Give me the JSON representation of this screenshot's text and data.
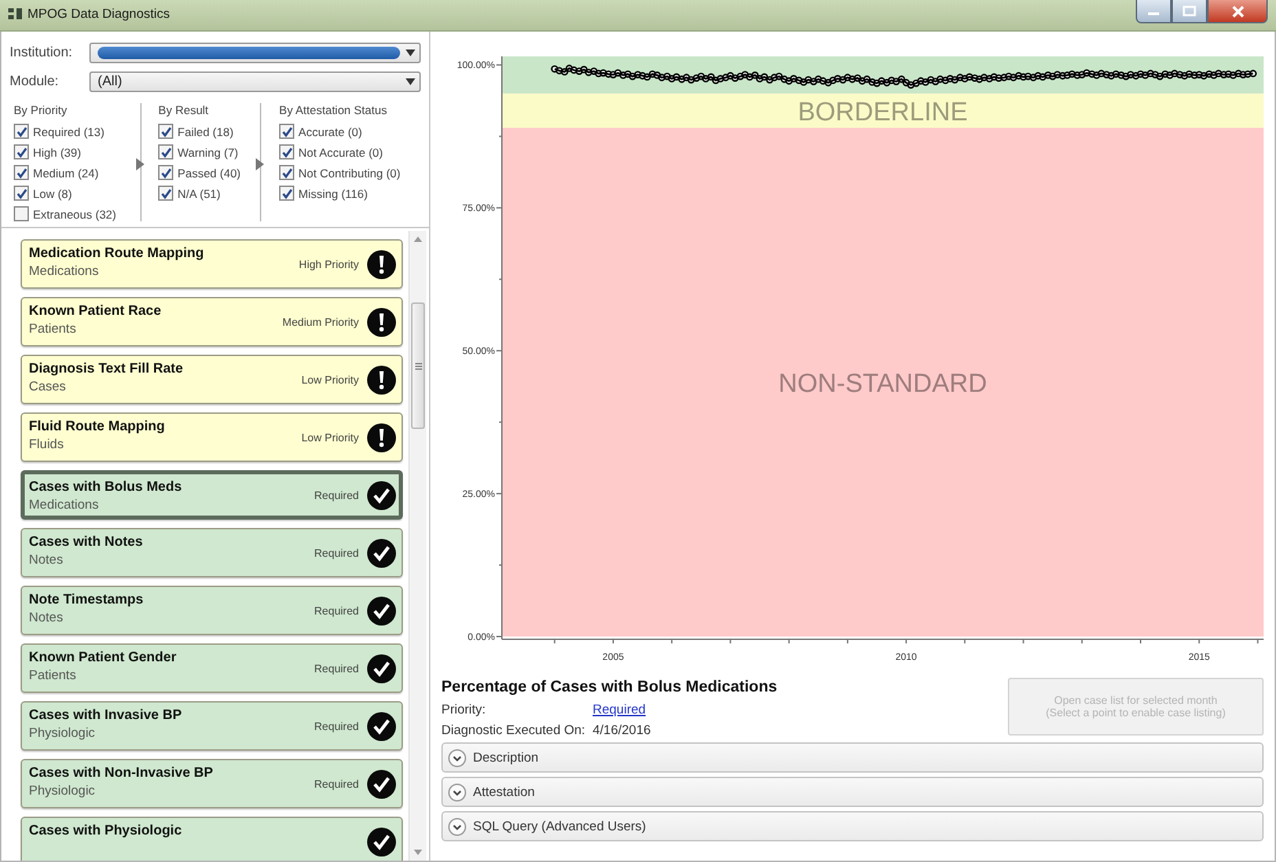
{
  "window": {
    "title": "MPOG Data Diagnostics"
  },
  "filters": {
    "institution": {
      "label": "Institution:"
    },
    "module": {
      "label": "Module:",
      "value": "(All)"
    },
    "groups": [
      {
        "title": "By Priority",
        "options": [
          {
            "label": "Required (13)",
            "checked": true
          },
          {
            "label": "High (39)",
            "checked": true
          },
          {
            "label": "Medium (24)",
            "checked": true
          },
          {
            "label": "Low (8)",
            "checked": true
          },
          {
            "label": "Extraneous (32)",
            "checked": false
          }
        ]
      },
      {
        "title": "By Result",
        "options": [
          {
            "label": "Failed (18)",
            "checked": true
          },
          {
            "label": "Warning (7)",
            "checked": true
          },
          {
            "label": "Passed (40)",
            "checked": true
          },
          {
            "label": "N/A (51)",
            "checked": true
          }
        ]
      },
      {
        "title": "By Attestation Status",
        "options": [
          {
            "label": "Accurate (0)",
            "checked": true
          },
          {
            "label": "Not Accurate (0)",
            "checked": true
          },
          {
            "label": "Not Contributing (0)",
            "checked": true
          },
          {
            "label": "Missing (116)",
            "checked": true
          }
        ]
      }
    ]
  },
  "diagnostics": [
    {
      "title": "Medication Route Mapping",
      "category": "Medications",
      "priority": "High Priority",
      "kind": "warning",
      "selected": false
    },
    {
      "title": "Known Patient Race",
      "category": "Patients",
      "priority": "Medium Priority",
      "kind": "warning",
      "selected": false
    },
    {
      "title": "Diagnosis Text Fill Rate",
      "category": "Cases",
      "priority": "Low Priority",
      "kind": "warning",
      "selected": false
    },
    {
      "title": "Fluid Route Mapping",
      "category": "Fluids",
      "priority": "Low Priority",
      "kind": "warning",
      "selected": false
    },
    {
      "title": "Cases with Bolus Meds",
      "category": "Medications",
      "priority": "Required",
      "kind": "passed",
      "selected": true
    },
    {
      "title": "Cases with Notes",
      "category": "Notes",
      "priority": "Required",
      "kind": "passed",
      "selected": false
    },
    {
      "title": "Note Timestamps",
      "category": "Notes",
      "priority": "Required",
      "kind": "passed",
      "selected": false
    },
    {
      "title": "Known Patient Gender",
      "category": "Patients",
      "priority": "Required",
      "kind": "passed",
      "selected": false
    },
    {
      "title": "Cases with Invasive BP",
      "category": "Physiologic",
      "priority": "Required",
      "kind": "passed",
      "selected": false
    },
    {
      "title": "Cases with Non-Invasive BP",
      "category": "Physiologic",
      "priority": "Required",
      "kind": "passed",
      "selected": false
    },
    {
      "title": "Cases with Physiologic",
      "kind": "passed",
      "selected": false
    }
  ],
  "chart": {
    "chart_data": {
      "type": "line",
      "xlim": [
        2003.1,
        2016.1
      ],
      "ylim": [
        0,
        101.5
      ],
      "xticks": [
        2005,
        2010,
        2015
      ],
      "yticks": [
        {
          "value": 0,
          "label": "0.00%"
        },
        {
          "value": 25,
          "label": "25.00%"
        },
        {
          "value": 50,
          "label": "50.00%"
        },
        {
          "value": 75,
          "label": "75.00%"
        },
        {
          "value": 100,
          "label": "100.00%"
        }
      ],
      "bands": [
        {
          "axis": "y",
          "from": 95,
          "to": 101.5,
          "color": "#c9e6c9"
        },
        {
          "axis": "y",
          "from": 89,
          "to": 95,
          "color": "#fbfbc8",
          "label": "BORDERLINE"
        },
        {
          "axis": "y",
          "from": 0,
          "to": 89,
          "color": "#ffcaca",
          "label": "NON-STANDARD"
        }
      ],
      "x": [
        2004,
        2004.08,
        2004.17,
        2004.25,
        2004.33,
        2004.42,
        2004.5,
        2004.58,
        2004.67,
        2004.75,
        2004.83,
        2004.92,
        2005,
        2005.08,
        2005.17,
        2005.25,
        2005.33,
        2005.42,
        2005.5,
        2005.58,
        2005.67,
        2005.75,
        2005.83,
        2005.92,
        2006,
        2006.08,
        2006.17,
        2006.25,
        2006.33,
        2006.42,
        2006.5,
        2006.58,
        2006.67,
        2006.75,
        2006.83,
        2006.92,
        2007,
        2007.08,
        2007.17,
        2007.25,
        2007.33,
        2007.42,
        2007.5,
        2007.58,
        2007.67,
        2007.75,
        2007.83,
        2007.92,
        2008,
        2008.08,
        2008.17,
        2008.25,
        2008.33,
        2008.42,
        2008.5,
        2008.58,
        2008.67,
        2008.75,
        2008.83,
        2008.92,
        2009,
        2009.08,
        2009.17,
        2009.25,
        2009.33,
        2009.42,
        2009.5,
        2009.58,
        2009.67,
        2009.75,
        2009.83,
        2009.92,
        2010,
        2010.08,
        2010.17,
        2010.25,
        2010.33,
        2010.42,
        2010.5,
        2010.58,
        2010.67,
        2010.75,
        2010.83,
        2010.92,
        2011,
        2011.08,
        2011.17,
        2011.25,
        2011.33,
        2011.42,
        2011.5,
        2011.58,
        2011.67,
        2011.75,
        2011.83,
        2011.92,
        2012,
        2012.08,
        2012.17,
        2012.25,
        2012.33,
        2012.42,
        2012.5,
        2012.58,
        2012.67,
        2012.75,
        2012.83,
        2012.92,
        2013,
        2013.08,
        2013.17,
        2013.25,
        2013.33,
        2013.42,
        2013.5,
        2013.58,
        2013.67,
        2013.75,
        2013.83,
        2013.92,
        2014,
        2014.08,
        2014.17,
        2014.25,
        2014.33,
        2014.42,
        2014.5,
        2014.58,
        2014.67,
        2014.75,
        2014.83,
        2014.92,
        2015,
        2015.08,
        2015.17,
        2015.25,
        2015.33,
        2015.42,
        2015.5,
        2015.58,
        2015.67,
        2015.75,
        2015.83,
        2015.92
      ],
      "series": [
        {
          "color": "#000000",
          "marker": "circle",
          "values": [
            99.3,
            99.0,
            98.8,
            99.4,
            99.1,
            98.9,
            99.2,
            98.7,
            98.9,
            98.5,
            98.6,
            98.4,
            98.3,
            98.6,
            98.2,
            98.4,
            98.0,
            98.3,
            98.1,
            97.9,
            98.4,
            98.2,
            97.8,
            98.0,
            97.6,
            97.9,
            97.5,
            97.8,
            97.4,
            97.7,
            98.0,
            97.6,
            97.9,
            97.3,
            97.6,
            97.8,
            98.1,
            97.7,
            98.0,
            98.3,
            97.9,
            98.2,
            97.6,
            97.9,
            97.4,
            97.8,
            98.0,
            97.5,
            97.2,
            97.6,
            97.3,
            97.0,
            97.4,
            97.1,
            97.5,
            97.2,
            96.9,
            97.3,
            97.6,
            97.4,
            97.8,
            97.5,
            97.7,
            97.2,
            97.5,
            97.0,
            96.8,
            97.2,
            96.9,
            97.3,
            97.1,
            97.5,
            96.9,
            96.5,
            96.8,
            97.2,
            97.0,
            97.4,
            97.1,
            97.5,
            97.3,
            97.6,
            97.4,
            97.8,
            97.6,
            97.9,
            97.7,
            97.5,
            97.8,
            97.6,
            97.9,
            97.7,
            97.8,
            98.0,
            97.8,
            98.1,
            97.9,
            98.0,
            97.8,
            98.1,
            97.9,
            98.2,
            98.0,
            98.3,
            98.1,
            98.2,
            98.4,
            98.2,
            98.3,
            98.6,
            98.4,
            98.2,
            98.5,
            98.3,
            98.1,
            98.4,
            98.2,
            98.0,
            98.3,
            98.1,
            98.4,
            98.2,
            98.5,
            98.3,
            98.0,
            98.4,
            98.2,
            98.5,
            98.3,
            98.1,
            98.4,
            98.2,
            98.3,
            98.1,
            98.4,
            98.2,
            98.5,
            98.3,
            98.4,
            98.2,
            98.5,
            98.3,
            98.4,
            98.5
          ]
        }
      ]
    }
  },
  "detail": {
    "title": "Percentage of Cases with Bolus Medications",
    "fields": [
      {
        "label": "Priority:",
        "value": "Required",
        "kind": "link"
      },
      {
        "label": "Diagnostic Executed On:",
        "value": "4/16/2016",
        "kind": "text"
      }
    ],
    "case_button": {
      "label": "Open case list for selected month\n(Select a point to enable case listing)",
      "disabled": true
    },
    "sections": [
      {
        "label": "Description",
        "expanded": false
      },
      {
        "label": "Attestation",
        "expanded": false
      },
      {
        "label": "SQL Query (Advanced Users)",
        "expanded": false
      }
    ]
  }
}
